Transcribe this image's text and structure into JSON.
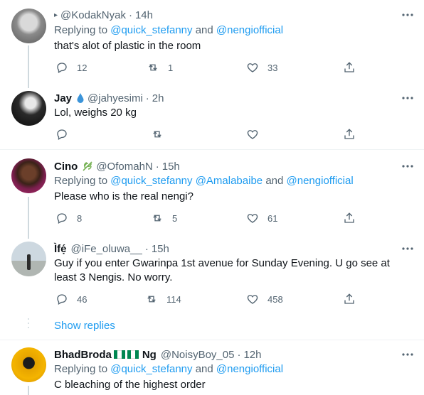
{
  "tweets": [
    {
      "name": "",
      "name_prefix": "▸",
      "handle": "@KodakNyak",
      "dot": "·",
      "time": "14h",
      "replying_label": "Replying to",
      "mention1": "@quick_stefanny",
      "and_label": "and",
      "mention2": "@nengiofficial",
      "text": "that's alot of plastic in the room",
      "reply_count": "12",
      "retweet_count": "1",
      "like_count": "33"
    },
    {
      "name": "Jay",
      "handle": "@jahyesimi",
      "dot": "·",
      "time": "2h",
      "text": "Lol, weighs 20 kg",
      "reply_count": "",
      "retweet_count": "",
      "like_count": ""
    },
    {
      "name": "Cino",
      "handle": "@OfomahN",
      "dot": "·",
      "time": "15h",
      "replying_label": "Replying to",
      "mention1": "@quick_stefanny",
      "mention_mid": "@Amalabaibe",
      "and_label": "and",
      "mention2": "@nengiofficial",
      "text": "Please who is the real nengi?",
      "reply_count": "8",
      "retweet_count": "5",
      "like_count": "61"
    },
    {
      "name": "Ìfẹ́",
      "handle": "@iFe_oluwa__",
      "dot": "·",
      "time": "15h",
      "text": "Guy if you enter Gwarinpa 1st avenue for Sunday Evening. U go see at least 3 Nengis. No worry.",
      "reply_count": "46",
      "retweet_count": "114",
      "like_count": "458"
    },
    {
      "name": "BhadBroda",
      "name_suffix": "Ng",
      "handle": "@NoisyBoy_05",
      "dot": "·",
      "time": "12h",
      "replying_label": "Replying to",
      "mention1": "@quick_stefanny",
      "and_label": "and",
      "mention2": "@nengiofficial",
      "text": "C bleaching of the highest order"
    }
  ],
  "show_replies": "Show replies",
  "colors": {
    "accent": "#1d9bf0",
    "muted": "#536471",
    "line": "#cfd9de",
    "flag_green": "#008751"
  },
  "icons": [
    "reply-icon",
    "retweet-icon",
    "like-icon",
    "share-icon",
    "more-icon",
    "water-drop-icon",
    "leaf-icon",
    "nigeria-flag-icon"
  ]
}
